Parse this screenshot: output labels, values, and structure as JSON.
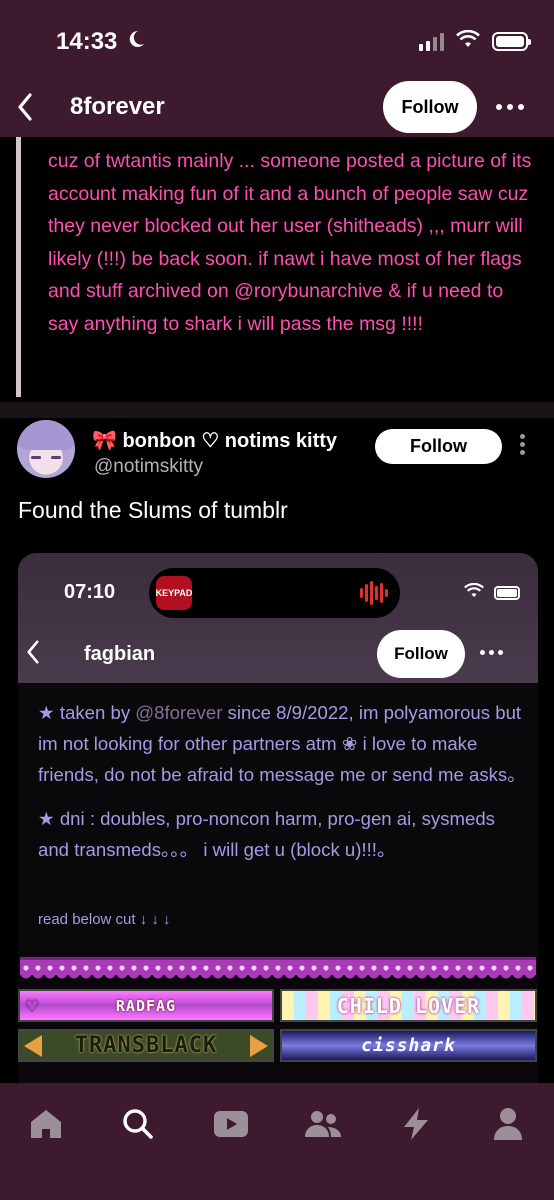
{
  "status_bar": {
    "time": "14:33"
  },
  "header": {
    "title": "8forever",
    "follow_label": "Follow"
  },
  "quote": {
    "text": "cuz of twtantis mainly ... someone posted a picture of its account making fun of it and a bunch of people saw cuz they never blocked out her user (shitheads) ,,, murr will likely (!!!) be back soon. if nawt i have most of her flags and stuff archived on @rorybunarchive & if u need to say anything to shark i will pass the msg !!!!"
  },
  "reblog": {
    "name": "🎀 bonbon ♡ notims kitty",
    "handle": "@notimskitty",
    "follow_label": "Follow",
    "text": "Found the Slums of tumblr"
  },
  "screenshot": {
    "time": "07:10",
    "island_logo_text": "KEYPAD",
    "title": "fagbian",
    "follow_label": "Follow",
    "desc1_a": "★ taken by ",
    "desc1_mention": "@8forever",
    "desc1_b": " since 8/9/2022, im polyamorous but im not looking for other partners atm ❀ i love to make friends, do not be afraid to message me or send me asks。",
    "desc2": "★ dni : doubles, pro-noncon harm, pro-gen ai, sysmeds and transmeds。。。 i will get u (block u)!!!。",
    "cut": "read below cut ↓ ↓ ↓",
    "banners": [
      "RADFAG",
      "CHILD LOVER",
      "TRANSBLACK",
      "cisshark"
    ]
  },
  "nav": {
    "items": [
      "home-icon",
      "search-icon",
      "video-icon",
      "communities-icon",
      "activity-icon",
      "account-icon"
    ]
  }
}
